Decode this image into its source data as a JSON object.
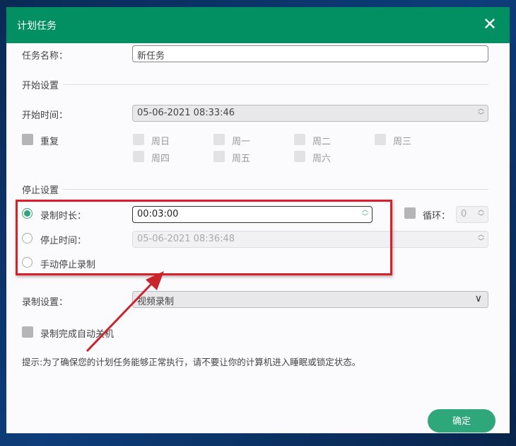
{
  "title": "计划任务",
  "task_name": {
    "label": "任务名称：",
    "value": "新任务"
  },
  "start_section": "开始设置",
  "start_time": {
    "label": "开始时间：",
    "value": "05-06-2021 08:33:46"
  },
  "repeat": {
    "label": "重复",
    "checked": false
  },
  "days": [
    "周日",
    "周一",
    "周二",
    "周三",
    "周四",
    "周五",
    "周六"
  ],
  "stop_section": "停止设置",
  "stop_options": [
    {
      "label": "录制时长：",
      "value": "00:03:00",
      "selected": true
    },
    {
      "label": "停止时间：",
      "value": "05-06-2021 08:36:48",
      "selected": false
    },
    {
      "label": "手动停止录制",
      "selected": false
    }
  ],
  "loop": {
    "label": "循环：",
    "value": "0",
    "checked": false
  },
  "record_settings": {
    "label": "录制设置：",
    "value": "视频录制"
  },
  "auto_shutdown": {
    "label": "录制完成自动关机",
    "checked": false
  },
  "tip": "提示:为了确保您的计划任务能够正常执行，请不要让你的计算机进入睡眠或锁定状态。",
  "ok_label": "确定",
  "colors": {
    "header": "#029063",
    "accent": "#2ea77a",
    "annotation": "#d6212a"
  }
}
